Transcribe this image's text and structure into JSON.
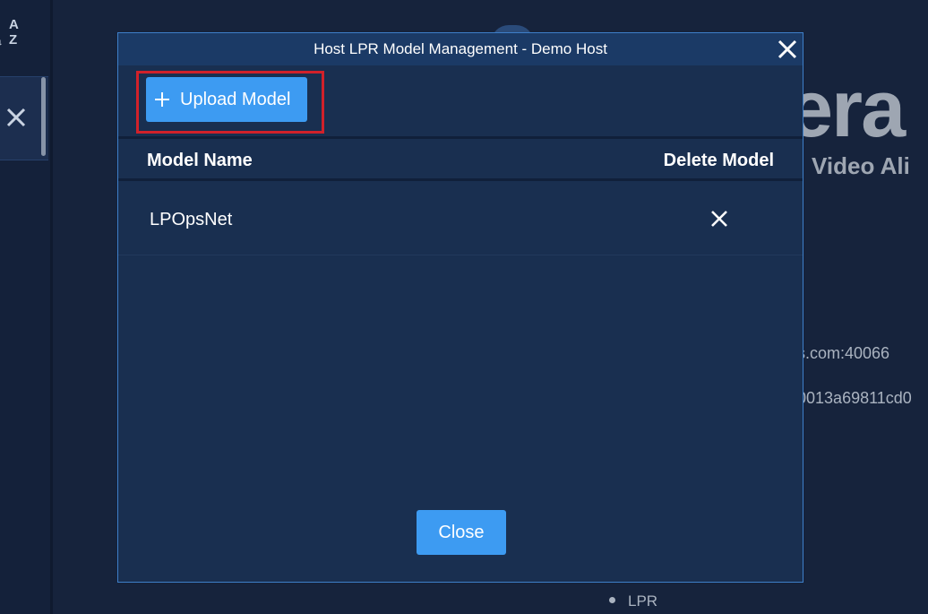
{
  "background": {
    "brand_text": "era",
    "tagline": "Video Ali",
    "line1": "es.com:40066",
    "line2": "00013a69811cd0",
    "bullet_item": "LPR"
  },
  "rail": {
    "sort_a": "A",
    "sort_z": "Z"
  },
  "modal": {
    "title": "Host LPR Model Management - Demo Host",
    "upload_label": "Upload Model",
    "close_label": "Close",
    "columns": {
      "name": "Model Name",
      "delete": "Delete Model"
    },
    "rows": [
      {
        "name": "LPOpsNet"
      }
    ]
  },
  "colors": {
    "accent": "#3d9bf2",
    "highlight": "#d1212a",
    "modal_bg": "#192f50"
  }
}
